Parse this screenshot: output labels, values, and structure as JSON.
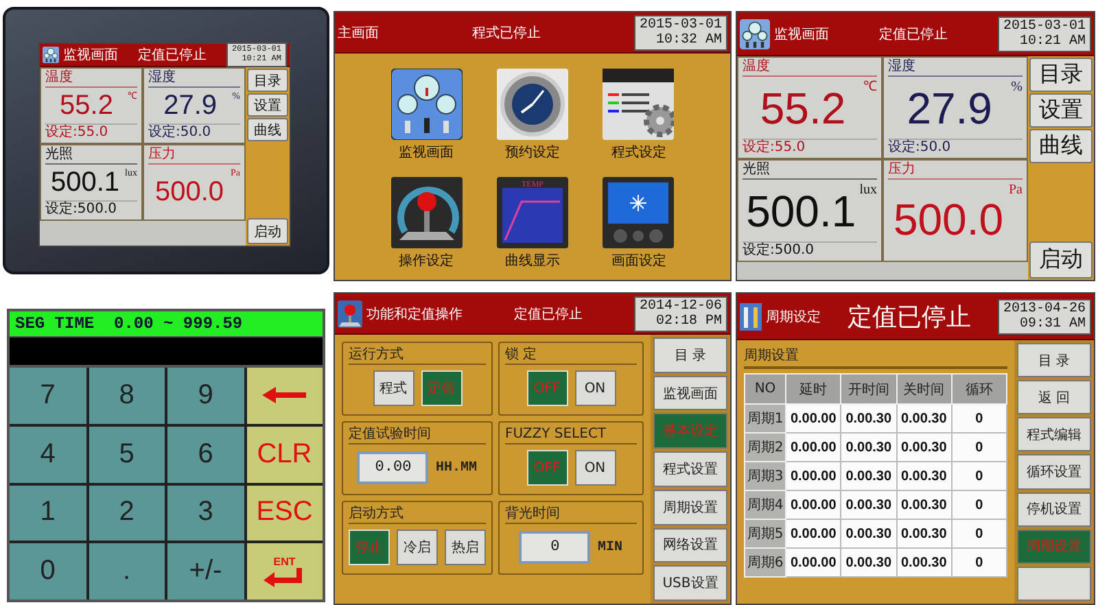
{
  "device_photo": {
    "screen": {
      "title": "监视画面",
      "status": "定值已停止",
      "date": "2015-03-01",
      "time": "10:21 AM",
      "cells": [
        {
          "label": "温度",
          "value": "55.2",
          "unit": "℃",
          "setpoint": "设定:55.0",
          "color": "#b0101c"
        },
        {
          "label": "湿度",
          "value": "27.9",
          "unit": "%",
          "setpoint": "设定:50.0",
          "color": "#1c1c52"
        },
        {
          "label": "光照",
          "value": "500.1",
          "unit": "lux",
          "setpoint": "设定:500.0",
          "color": "#101010"
        },
        {
          "label": "压力",
          "value": "500.0",
          "unit": "Pa",
          "color": "#c0101c"
        }
      ],
      "menu": [
        "目录",
        "设置",
        "曲线"
      ],
      "start": "启动"
    }
  },
  "main_menu": {
    "title": "主画面",
    "status": "程式已停止",
    "date": "2015-03-01",
    "time": "10:32 AM",
    "items": [
      {
        "label": "监视画面",
        "kind": "gauges"
      },
      {
        "label": "预约设定",
        "kind": "clock"
      },
      {
        "label": "程式设定",
        "kind": "gears"
      },
      {
        "label": "操作设定",
        "kind": "joystick"
      },
      {
        "label": "曲线显示",
        "kind": "chart",
        "icon_text": "TEMP"
      },
      {
        "label": "画面设定",
        "kind": "display"
      }
    ]
  },
  "monitor_screen": {
    "title": "监视画面",
    "status": "定值已停止",
    "date": "2015-03-01",
    "time": "10:21 AM",
    "cells": [
      {
        "label": "温度",
        "value": "55.2",
        "unit": "℃",
        "setpoint": "设定:55.0",
        "color": "#b0101c"
      },
      {
        "label": "湿度",
        "value": "27.9",
        "unit": "%",
        "setpoint": "设定:50.0",
        "color": "#1c1c52"
      },
      {
        "label": "光照",
        "value": "500.1",
        "unit": "lux",
        "setpoint": "设定:500.0",
        "color": "#101010"
      },
      {
        "label": "压力",
        "value": "500.0",
        "unit": "Pa",
        "color": "#c0101c"
      }
    ],
    "menu": [
      "目录",
      "设置",
      "曲线"
    ],
    "start": "启动"
  },
  "keypad": {
    "range": "SEG TIME  0.00 ~ 999.59",
    "keys": [
      {
        "kind": "digit",
        "label": "7"
      },
      {
        "kind": "digit",
        "label": "8"
      },
      {
        "kind": "digit",
        "label": "9"
      },
      {
        "kind": "back"
      },
      {
        "kind": "digit",
        "label": "4"
      },
      {
        "kind": "digit",
        "label": "5"
      },
      {
        "kind": "digit",
        "label": "6"
      },
      {
        "kind": "func",
        "label": "CLR"
      },
      {
        "kind": "digit",
        "label": "1"
      },
      {
        "kind": "digit",
        "label": "2"
      },
      {
        "kind": "digit",
        "label": "3"
      },
      {
        "kind": "func",
        "label": "ESC"
      },
      {
        "kind": "digit",
        "label": "0"
      },
      {
        "kind": "digit",
        "label": "."
      },
      {
        "kind": "digit",
        "label": "+/-"
      },
      {
        "kind": "enter",
        "label": "ENT"
      }
    ]
  },
  "settings_screen": {
    "title": "功能和定值操作",
    "status": "定值已停止",
    "date": "2014-12-06",
    "time": "02:18 PM",
    "groups": [
      {
        "title": "运行方式",
        "kind": "options",
        "options": [
          {
            "label": "程式",
            "selected": false
          },
          {
            "label": "定值",
            "selected": true
          }
        ]
      },
      {
        "title": "锁 定",
        "kind": "options",
        "options": [
          {
            "label": "OFF",
            "selected": true
          },
          {
            "label": "ON",
            "selected": false
          }
        ]
      },
      {
        "title": "定值试验时间",
        "kind": "field",
        "value": "0.00",
        "unit": "HH.MM"
      },
      {
        "title": "FUZZY SELECT",
        "kind": "options",
        "options": [
          {
            "label": "OFF",
            "selected": true
          },
          {
            "label": "ON",
            "selected": false
          }
        ]
      },
      {
        "title": "启动方式",
        "kind": "options",
        "options": [
          {
            "label": "停止",
            "selected": true
          },
          {
            "label": "冷启",
            "selected": false
          },
          {
            "label": "热启",
            "selected": false
          }
        ]
      },
      {
        "title": "背光时间",
        "kind": "field",
        "value": "0",
        "unit": "MIN"
      }
    ],
    "sidebar": [
      {
        "label": "目 录",
        "selected": false
      },
      {
        "label": "监视画面",
        "selected": false
      },
      {
        "label": "基本设定",
        "selected": true
      },
      {
        "label": "程式设置",
        "selected": false
      },
      {
        "label": "周期设置",
        "selected": false
      },
      {
        "label": "网络设置",
        "selected": false
      },
      {
        "label": "USB设置",
        "selected": false
      }
    ]
  },
  "cycle_screen": {
    "title": "周期设定",
    "status": "定值已停止",
    "date": "2013-04-26",
    "time": "09:31 AM",
    "section": "周期设置",
    "columns": [
      "NO",
      "延时",
      "开时间",
      "关时间",
      "循环"
    ],
    "rows": [
      [
        "周期1",
        "0.00.00",
        "0.00.30",
        "0.00.30",
        "0"
      ],
      [
        "周期2",
        "0.00.00",
        "0.00.30",
        "0.00.30",
        "0"
      ],
      [
        "周期3",
        "0.00.00",
        "0.00.30",
        "0.00.30",
        "0"
      ],
      [
        "周期4",
        "0.00.00",
        "0.00.30",
        "0.00.30",
        "0"
      ],
      [
        "周期5",
        "0.00.00",
        "0.00.30",
        "0.00.30",
        "0"
      ],
      [
        "周期6",
        "0.00.00",
        "0.00.30",
        "0.00.30",
        "0"
      ]
    ],
    "sidebar": [
      {
        "label": "目 录",
        "selected": false
      },
      {
        "label": "返 回",
        "selected": false
      },
      {
        "label": "程式编辑",
        "selected": false
      },
      {
        "label": "循环设置",
        "selected": false
      },
      {
        "label": "停机设置",
        "selected": false
      },
      {
        "label": "周期设置",
        "selected": true
      },
      {
        "selected": false
      }
    ]
  }
}
